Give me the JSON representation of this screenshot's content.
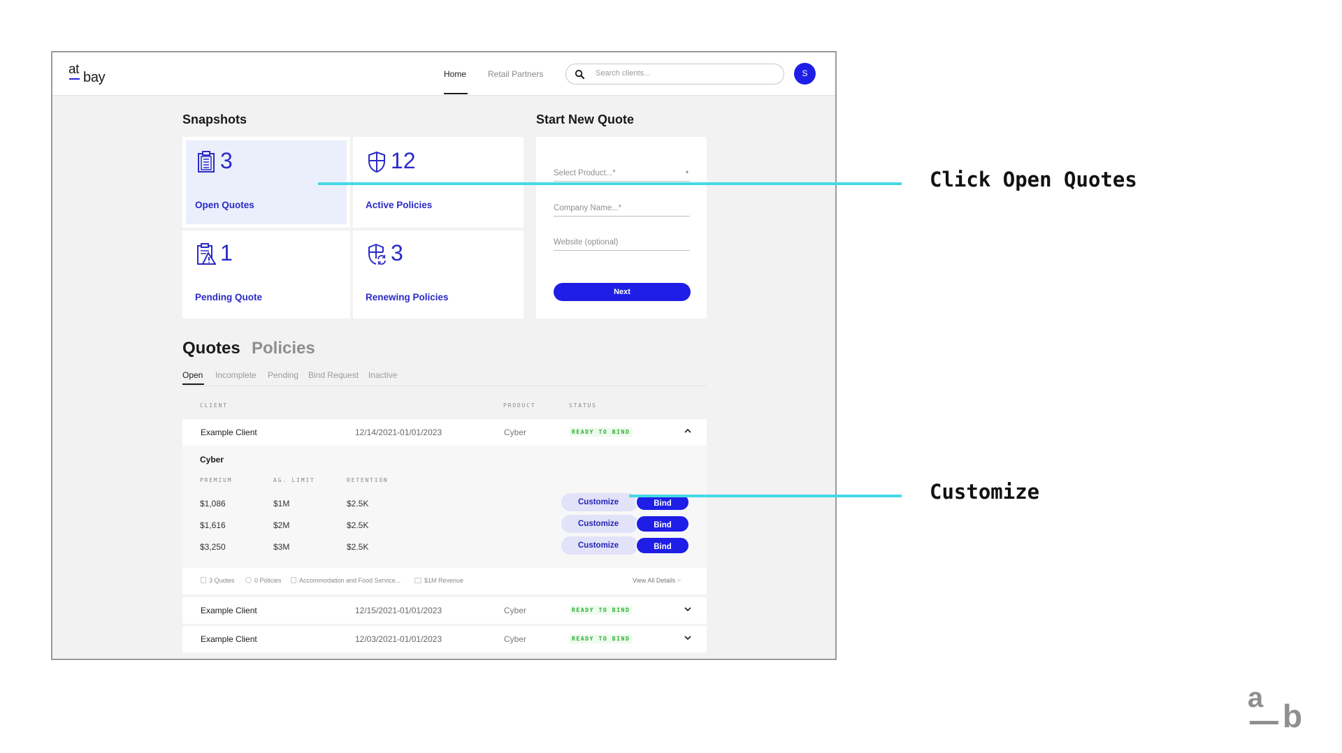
{
  "header": {
    "logo_top": "at",
    "logo_bottom": "bay",
    "nav": [
      {
        "label": "Home",
        "active": true
      },
      {
        "label": "Retail Partners",
        "active": false
      }
    ],
    "search_placeholder": "Search clients...",
    "avatar_initial": "S"
  },
  "snapshots": {
    "title": "Snapshots",
    "cards": [
      {
        "icon": "clipboard-icon",
        "count": "3",
        "label": "Open Quotes",
        "highlighted": true
      },
      {
        "icon": "shield-icon",
        "count": "12",
        "label": "Active Policies",
        "highlighted": false
      },
      {
        "icon": "clipboard-warning-icon",
        "count": "1",
        "label": "Pending Quote",
        "highlighted": false
      },
      {
        "icon": "shield-refresh-icon",
        "count": "3",
        "label": "Renewing Policies",
        "highlighted": false
      }
    ]
  },
  "start_quote": {
    "title": "Start New Quote",
    "product_placeholder": "Select Product...*",
    "company_placeholder": "Company Name...*",
    "website_placeholder": "Website (optional)",
    "next_label": "Next"
  },
  "tabs": {
    "main": [
      {
        "label": "Quotes",
        "active": true
      },
      {
        "label": "Policies",
        "active": false
      }
    ],
    "sub": [
      {
        "label": "Open",
        "active": true
      },
      {
        "label": "Incomplete",
        "active": false
      },
      {
        "label": "Pending",
        "active": false
      },
      {
        "label": "Bind Request",
        "active": false
      },
      {
        "label": "Inactive",
        "active": false
      }
    ]
  },
  "table": {
    "columns": {
      "client": "CLIENT",
      "product": "PRODUCT",
      "status": "STATUS"
    },
    "rows": [
      {
        "client": "Example Client",
        "dates": "12/14/2021-01/01/2023",
        "product": "Cyber",
        "status": "READY TO BIND",
        "expanded": true
      },
      {
        "client": "Example Client",
        "dates": "12/15/2021-01/01/2023",
        "product": "Cyber",
        "status": "READY TO BIND",
        "expanded": false
      },
      {
        "client": "Example Client",
        "dates": "12/03/2021-01/01/2023",
        "product": "Cyber",
        "status": "READY TO BIND",
        "expanded": false
      }
    ],
    "expanded_detail": {
      "title": "Cyber",
      "columns": {
        "premium": "PREMIUM",
        "limit": "AG. LIMIT",
        "retention": "RETENTION"
      },
      "quotes": [
        {
          "premium": "$1,086",
          "limit": "$1M",
          "retention": "$2.5K"
        },
        {
          "premium": "$1,616",
          "limit": "$2M",
          "retention": "$2.5K"
        },
        {
          "premium": "$3,250",
          "limit": "$3M",
          "retention": "$2.5K"
        }
      ],
      "customize_label": "Customize",
      "bind_label": "Bind",
      "meta": {
        "quotes": "3 Quotes",
        "policies": "0 Policies",
        "industry": "Accommodation and Food Service...",
        "revenue": "$1M Revenue"
      },
      "view_all": "View All Details",
      "view_all_arrow": ">"
    }
  },
  "annotations": [
    {
      "text": "Click Open Quotes"
    },
    {
      "text": "Customize"
    }
  ],
  "corner_logo": {
    "top": "a",
    "bottom": "b"
  },
  "colors": {
    "brand_blue": "#1e1ee6",
    "label_blue": "#2a2ac8",
    "status_green": "#27b02f",
    "annotation_cyan": "#45d9e6"
  }
}
